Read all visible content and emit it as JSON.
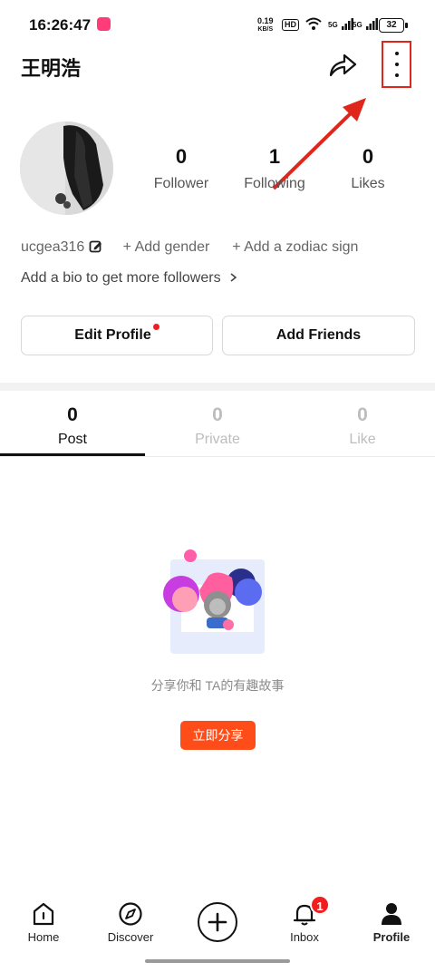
{
  "status_bar": {
    "time": "16:26:47",
    "net_speed_value": "0.19",
    "net_speed_unit": "KB/S",
    "hd_label": "HD",
    "sig1": "5G",
    "sig2": "5G",
    "battery": "32"
  },
  "header": {
    "username": "王明浩",
    "share_icon": "share-arrow-icon",
    "more_icon": "more-vertical-icon"
  },
  "profile": {
    "stats": [
      {
        "value": "0",
        "label": "Follower"
      },
      {
        "value": "1",
        "label": "Following"
      },
      {
        "value": "0",
        "label": "Likes"
      }
    ],
    "handle": "ucgea316",
    "add_gender": "+ Add gender",
    "add_zodiac": "+ Add a zodiac sign",
    "bio_prompt": "Add a bio to get more followers",
    "edit_profile": "Edit Profile",
    "add_friends": "Add Friends"
  },
  "tabs": [
    {
      "count": "0",
      "label": "Post",
      "active": true
    },
    {
      "count": "0",
      "label": "Private",
      "active": false
    },
    {
      "count": "0",
      "label": "Like",
      "active": false
    }
  ],
  "empty_state": {
    "message": "分享你和 TA的有趣故事",
    "button": "立即分享"
  },
  "bottom_nav": {
    "home": "Home",
    "discover": "Discover",
    "inbox": "Inbox",
    "profile": "Profile",
    "inbox_badge": "1"
  },
  "colors": {
    "accent": "#ff4d1a",
    "highlight_red": "#e0251b"
  }
}
